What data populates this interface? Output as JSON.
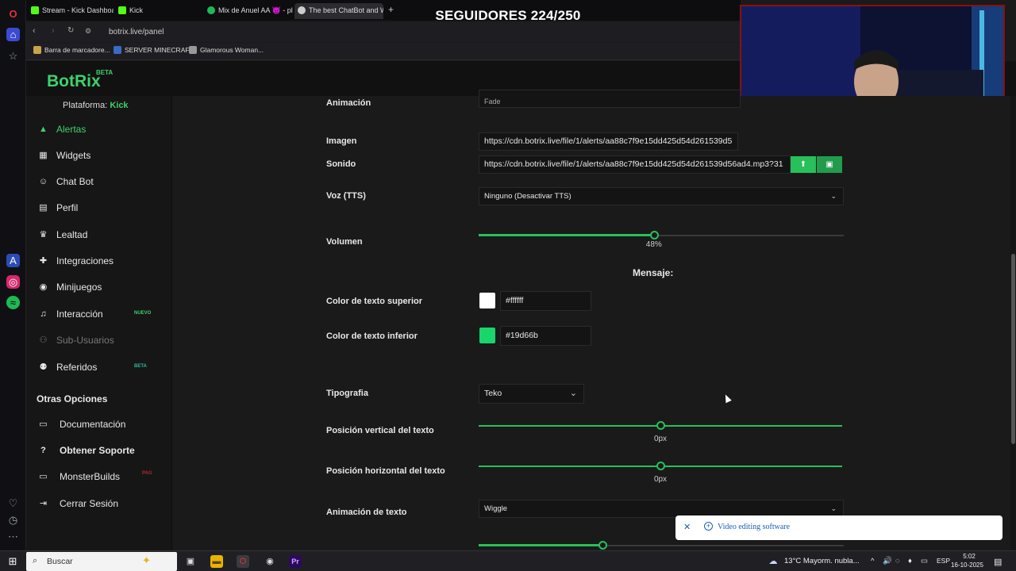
{
  "browser": {
    "tabs": [
      {
        "label": "Stream - Kick Dashboard",
        "icon": "kick-icon"
      },
      {
        "label": "Kick",
        "icon": "kick-icon"
      },
      {
        "label": "Mix de Anuel AA 😈 - playl",
        "icon": "spotify-icon"
      },
      {
        "label": "The best ChatBot and Wi",
        "icon": "botrix-icon"
      }
    ],
    "url": "botrix.live/panel",
    "bookmarks": [
      "Barra de marcadore...",
      "SERVER MINECRAFT",
      "Glamorous Woman..."
    ]
  },
  "overlay": {
    "title": "SEGUIDORES 224/250"
  },
  "app": {
    "logo": "BotRix",
    "logo_badge": "BETA"
  },
  "sidebar": {
    "platform_label": "Plataforma:",
    "platform_value": "Kick",
    "items": [
      {
        "label": "Alertas",
        "icon": "alert-icon",
        "state": "active"
      },
      {
        "label": "Widgets",
        "icon": "widgets-icon"
      },
      {
        "label": "Chat Bot",
        "icon": "robot-icon"
      },
      {
        "label": "Perfil",
        "icon": "id-card-icon"
      },
      {
        "label": "Lealtad",
        "icon": "trophy-icon"
      },
      {
        "label": "Integraciones",
        "icon": "puzzle-icon"
      },
      {
        "label": "Minijuegos",
        "icon": "gamepad-icon"
      },
      {
        "label": "Interacción",
        "icon": "music-icon",
        "badge": "NUEVO",
        "badge_color": "#3fd16b"
      },
      {
        "label": "Sub-Usuarios",
        "icon": "users-icon",
        "state": "muted"
      },
      {
        "label": "Referidos",
        "icon": "user-group-icon",
        "badge": "BETA",
        "badge_color": "#2fb8a0"
      }
    ],
    "other_title": "Otras Opciones",
    "other_items": [
      {
        "label": "Documentación",
        "icon": "document-icon"
      },
      {
        "label": "Obtener Soporte",
        "icon": "help-icon"
      },
      {
        "label": "MonsterBuilds",
        "icon": "laptop-icon",
        "badge": "PAG",
        "badge_color": "#b02a2a"
      },
      {
        "label": "Cerrar Sesión",
        "icon": "logout-icon"
      }
    ]
  },
  "form": {
    "animation_label": "Animación",
    "animation_value": "Fade",
    "image_label": "Imagen",
    "image_value": "https://cdn.botrix.live/file/1/alerts/aa88c7f9e15dd425d54d261539d5",
    "sound_label": "Sonido",
    "sound_value": "https://cdn.botrix.live/file/1/alerts/aa88c7f9e15dd425d54d261539d56ad4.mp3?31",
    "tts_label": "Voz (TTS)",
    "tts_value": "Ninguno (Desactivar TTS)",
    "volume_label": "Volumen",
    "volume_value": 48,
    "volume_text": "48%",
    "message_title": "Mensaje:",
    "top_color_label": "Color de texto superior",
    "top_color_value": "#ffffff",
    "bottom_color_label": "Color de texto inferior",
    "bottom_color_value": "#19d66b",
    "font_label": "Tipografia",
    "font_value": "Teko",
    "vpos_label": "Posición vertical del texto",
    "vpos_value": 50,
    "vpos_text": "0px",
    "hpos_label": "Posición horizontal del texto",
    "hpos_value": 50,
    "hpos_text": "0px",
    "text_anim_label": "Animación de texto",
    "text_anim_value": "Wiggle"
  },
  "notification": {
    "text": "Video editing software"
  },
  "taskbar": {
    "search_placeholder": "Buscar",
    "weather": "13°C  Mayorm. nubla...",
    "lang": "ESP",
    "time": "5:02",
    "date": "16-10-2025"
  }
}
